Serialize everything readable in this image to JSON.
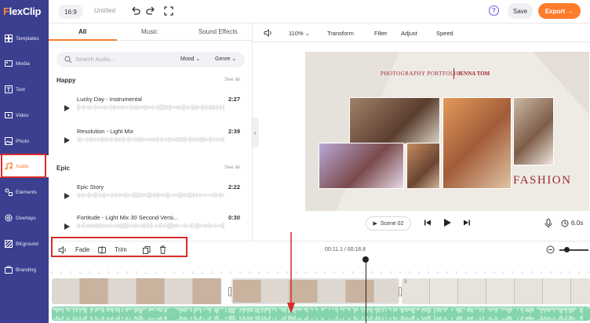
{
  "app": {
    "logo_first": "F",
    "logo_rest": "lexClip",
    "ratio": "16:9",
    "title": "Untitled",
    "save_label": "Save",
    "export_label": "Export",
    "help_label": "?"
  },
  "sidebar": {
    "items": [
      {
        "label": "Templates",
        "icon": "templates-icon"
      },
      {
        "label": "Media",
        "icon": "media-icon"
      },
      {
        "label": "Text",
        "icon": "text-icon"
      },
      {
        "label": "Video",
        "icon": "video-icon"
      },
      {
        "label": "Photo",
        "icon": "photo-icon"
      },
      {
        "label": "Audio",
        "icon": "audio-icon",
        "active": true
      },
      {
        "label": "Elements",
        "icon": "elements-icon"
      },
      {
        "label": "Overlays",
        "icon": "overlays-icon"
      },
      {
        "label": "BKground",
        "icon": "background-icon"
      },
      {
        "label": "Branding",
        "icon": "branding-icon"
      }
    ]
  },
  "audio_panel": {
    "tabs": [
      "All",
      "Music",
      "Sound Effects"
    ],
    "search_placeholder": "Search Audio...",
    "filter_mood": "Mood",
    "filter_genre": "Genre",
    "groups": [
      {
        "title": "Happy",
        "see_all": "See all",
        "tracks": [
          {
            "name": "Lucky Day - Instrumental",
            "duration": "2:27"
          },
          {
            "name": "Resolution - Light Mix",
            "duration": "2:39"
          }
        ]
      },
      {
        "title": "Epic",
        "see_all": "See all",
        "tracks": [
          {
            "name": "Epic Story",
            "duration": "2:22"
          },
          {
            "name": "Fortitude - Light Mix 30 Second Versi...",
            "duration": "0:30"
          }
        ]
      }
    ]
  },
  "preview_toolbar": {
    "zoom": "110%",
    "items": [
      "Transform",
      "Filter",
      "Adjust",
      "Speed"
    ]
  },
  "canvas": {
    "title_left": "PHOTOGRAPHY PORTFOLIO",
    "title_right": "JENNA TOM",
    "headline": "FASHION"
  },
  "player": {
    "scene": "Scene 02",
    "duration": "6.0s"
  },
  "timeline_toolbar": {
    "fade": "Fade",
    "trim": "Trim",
    "timecode": "00:11.1 / 00:18.8"
  },
  "timeline": {
    "clip_index_label": "3"
  },
  "colors": {
    "sidebar_bg": "#3b3f8f",
    "accent": "#ff7c2b",
    "highlight_border": "#d92b2b",
    "audio_wave": "#7ccfa6"
  }
}
